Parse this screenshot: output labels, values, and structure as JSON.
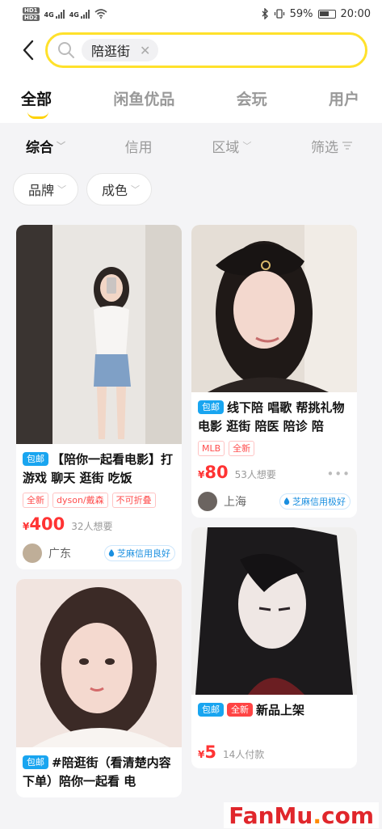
{
  "status_bar": {
    "sim1": "HD1",
    "sim2": "HD2",
    "net1": "4G",
    "net2": "4G",
    "battery_pct": "59%",
    "time": "20:00"
  },
  "search": {
    "query": "陪逛街"
  },
  "tabs": [
    {
      "label": "全部",
      "active": true
    },
    {
      "label": "闲鱼优品",
      "active": false
    },
    {
      "label": "会玩",
      "active": false
    },
    {
      "label": "用户",
      "active": false
    }
  ],
  "filters": [
    "综合",
    "信用",
    "区域",
    "筛选"
  ],
  "pills": [
    "品牌",
    "成色"
  ],
  "cards": [
    {
      "badges": [
        "包邮"
      ],
      "title": "【陪你一起看电影】打游戏 聊天 逛街 吃饭",
      "tags": [
        "全新",
        "dyson/戴森",
        "不可折叠"
      ],
      "price_symbol": "¥",
      "price": "400",
      "wants": "32人想要",
      "location": "广东",
      "credit": "芝麻信用良好"
    },
    {
      "badges": [
        "包邮"
      ],
      "title": "线下陪 唱歌 帮挑礼物 电影 逛街 陪医 陪诊 陪",
      "tags": [
        "MLB",
        "全新"
      ],
      "price_symbol": "¥",
      "price": "80",
      "wants": "53人想要",
      "location": "上海",
      "credit": "芝麻信用极好"
    },
    {
      "badges": [
        "包邮"
      ],
      "title": "#陪逛街（看清楚内容下单）陪你一起看 电"
    },
    {
      "badges": [
        "包邮",
        "全新"
      ],
      "title": "新品上架",
      "price_symbol": "¥",
      "price": "5",
      "wants": "14人付款"
    }
  ],
  "watermark": {
    "main": "FanMu",
    "dot": ".",
    "suffix": "com"
  },
  "colors": {
    "accent_yellow": "#ffe12b",
    "price_red": "#ff3333",
    "badge_blue": "#19a5f0",
    "credit_blue": "#1a8fe0"
  }
}
